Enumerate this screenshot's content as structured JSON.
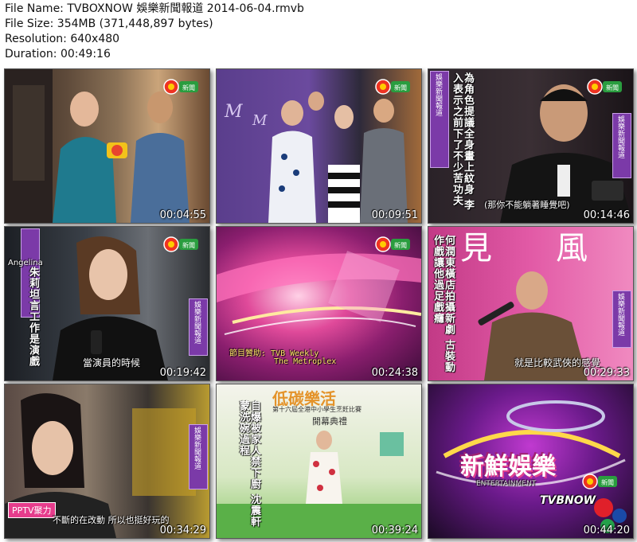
{
  "file_info": {
    "file_name": "File Name: TVBOXNOW 娛樂新聞報道 2014-06-04.rmvb",
    "file_size": "File Size: 354MB (371,448,897 bytes)",
    "resolution": "Resolution: 640x480",
    "duration": "Duration: 00:49:16"
  },
  "thumbnails": [
    {
      "timecode": "00:04:55"
    },
    {
      "timecode": "00:09:51"
    },
    {
      "timecode": "00:14:46",
      "caption_vertical": "為角色提議全身畫上紋身 李入表示之前下了不少苦功夫",
      "subtitle": "(那你不能躺著睡覺吧)",
      "strip": "娛樂新聞報道"
    },
    {
      "timecode": "00:19:42",
      "name_tag": "Angelina",
      "caption_vertical": "朱莉坦言工作是演戲",
      "subtitle": "當演員的時候",
      "strip": "娛樂新聞報道"
    },
    {
      "timecode": "00:24:38",
      "sponsor_line1": "節目贊助: TVB Weekly",
      "sponsor_line2": "The Metroplex"
    },
    {
      "timecode": "00:29:33",
      "caption_vertical": "何潤東橫店拍攝新劇 古裝動作戲讓他過足戲癮",
      "subtitle": "就是比較武俠的感覺",
      "strip": "娛樂新聞報道"
    },
    {
      "timecode": "00:34:29",
      "subtitle": "不斷的在改動 所以也挺好玩的",
      "logo_text": "PPTV聚力",
      "strip": "娛樂新聞報道"
    },
    {
      "timecode": "00:39:24",
      "banner": "低碳樂活",
      "banner_sub": "第十六屆全港中小學生烹飪比賽",
      "banner_sub2": "開幕典禮",
      "caption_vertical": "自爆被家人禁下廚 沈震軒蒙洗碗過程"
    },
    {
      "timecode": "00:44:20",
      "title": "新鮮娛樂",
      "watermark": "TVBNOW",
      "sub": "ENTERTAINMENT"
    }
  ],
  "colors": {
    "shadow": "#444444",
    "purple": "#7b3aa8",
    "magenta": "#d43c8f"
  }
}
